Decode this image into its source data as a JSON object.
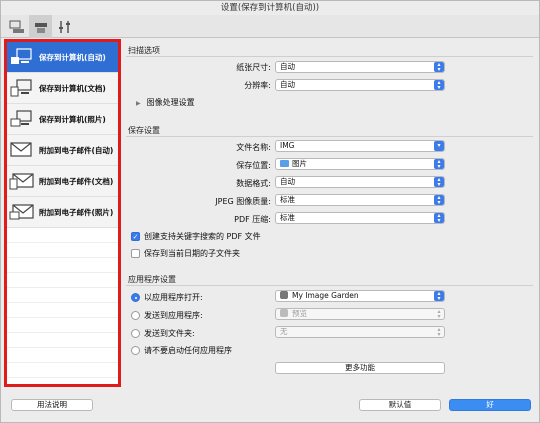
{
  "window": {
    "title": "设置(保存到计算机(自动))"
  },
  "toolbar": {
    "tabs": [
      {
        "icon": "scan-from-computer-icon"
      },
      {
        "icon": "scanner-panel-icon"
      },
      {
        "icon": "general-settings-icon"
      }
    ]
  },
  "sidebar": {
    "items": [
      {
        "label": "保存到计算机(自动)",
        "icon": "save-to-computer-icon",
        "active": true
      },
      {
        "label": "保存到计算机(文档)",
        "icon": "save-document-icon"
      },
      {
        "label": "保存到计算机(照片)",
        "icon": "save-photo-icon"
      },
      {
        "label": "附加到电子邮件(自动)",
        "icon": "email-attach-icon"
      },
      {
        "label": "附加到电子邮件(文档)",
        "icon": "email-document-icon"
      },
      {
        "label": "附加到电子邮件(照片)",
        "icon": "email-photo-icon"
      }
    ]
  },
  "scan_options": {
    "title": "扫描选项",
    "paper_size_label": "纸张尺寸:",
    "paper_size_value": "自动",
    "resolution_label": "分辨率:",
    "resolution_value": "自动",
    "image_processing_label": "图像处理设置"
  },
  "save_settings": {
    "title": "保存设置",
    "file_name_label": "文件名称:",
    "file_name_value": "IMG",
    "save_in_label": "保存位置:",
    "save_in_value": "图片",
    "data_format_label": "数据格式:",
    "data_format_value": "自动",
    "jpeg_quality_label": "JPEG 图像质量:",
    "jpeg_quality_value": "标准",
    "pdf_compression_label": "PDF 压缩:",
    "pdf_compression_value": "标准",
    "keyword_pdf_label": "创建支持关键字搜索的 PDF 文件",
    "keyword_pdf_checked": true,
    "subfolder_label": "保存到当前日期的子文件夹",
    "subfolder_checked": false
  },
  "app_settings": {
    "title": "应用程序设置",
    "open_with_label": "以应用程序打开:",
    "open_with_value": "My Image Garden",
    "send_app_label": "发送到应用程序:",
    "send_app_value": "预览",
    "send_folder_label": "发送到文件夹:",
    "send_folder_value": "无",
    "no_app_label": "请不要启动任何应用程序",
    "more_functions_label": "更多功能",
    "selected": "open_with"
  },
  "footer": {
    "instructions_label": "用法说明",
    "defaults_label": "默认值",
    "ok_label": "好"
  },
  "colors": {
    "accent": "#3b7bea",
    "highlight_border": "#e01b1b"
  }
}
